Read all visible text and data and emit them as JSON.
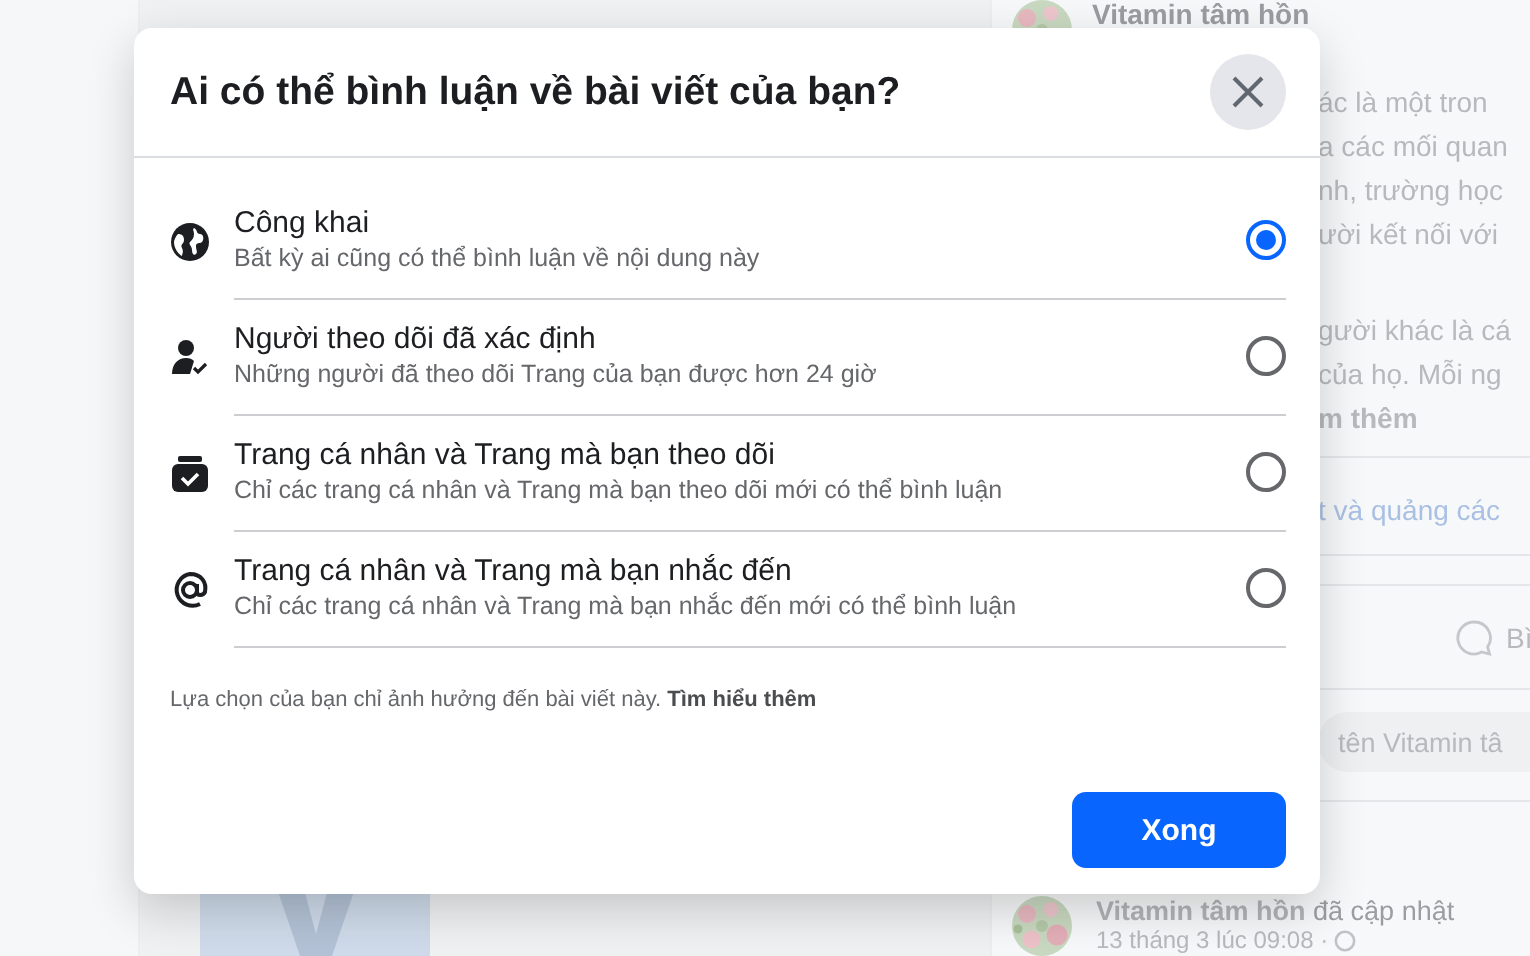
{
  "background": {
    "top_post_author": "Vitamin tâm hồn",
    "text_lines": [
      "ác là một tron",
      "a các mối quan",
      "nh, trường học",
      "ười kết nối với"
    ],
    "text_lines_2": [
      "gười khác là cá",
      "của họ. Mỗi ng"
    ],
    "read_more": "m thêm",
    "link": "t và quảng các",
    "comment_button": "Bì",
    "comment_field": {
      "placeholder": "tên Vitamin tâ"
    },
    "next_post": {
      "author": "Vitamin tâm hồn",
      "action": "đã cập nhật",
      "time": "13 tháng 3 lúc 09:08 ·"
    }
  },
  "dialog": {
    "title": "Ai có thể bình luận về bài viết của bạn?",
    "options": [
      {
        "kind": "globe",
        "label": "Công khai",
        "description": "Bất kỳ ai cũng có thể bình luận về nội dung này",
        "selected": true
      },
      {
        "kind": "follower",
        "label": "Người theo dõi đã xác định",
        "description": "Những người đã theo dõi Trang của bạn được hơn 24 giờ",
        "selected": false
      },
      {
        "kind": "inbox",
        "label": "Trang cá nhân và Trang mà bạn theo dõi",
        "description": "Chỉ các trang cá nhân và Trang mà bạn theo dõi mới có thể bình luận",
        "selected": false
      },
      {
        "kind": "at",
        "label": "Trang cá nhân và Trang mà bạn nhắc đến",
        "description": "Chỉ các trang cá nhân và Trang mà bạn nhắc đến mới có thể bình luận",
        "selected": false
      }
    ],
    "note": "Lựa chọn của bạn chỉ ảnh hưởng đến bài viết này.",
    "note_link": "Tìm hiểu thêm",
    "done_button": "Xong"
  }
}
